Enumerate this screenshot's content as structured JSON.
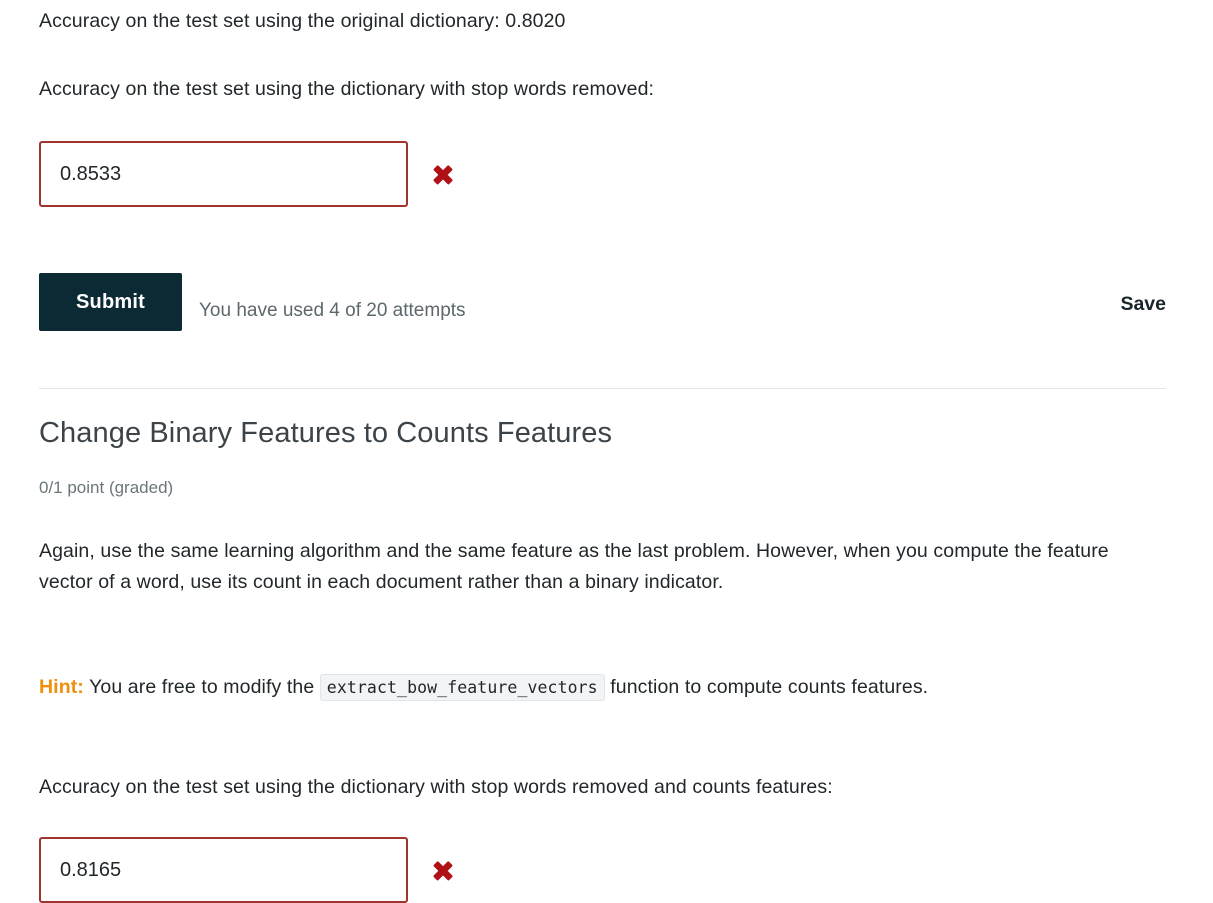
{
  "results": {
    "original_dictionary_line": "Accuracy on the test set using the original dictionary: 0.8020",
    "stopwords_removed_prompt": "Accuracy on the test set using the dictionary with stop words removed:"
  },
  "answer_1": {
    "value": "0.8533",
    "placeholder": "",
    "status": "incorrect",
    "status_icon": "cross-mark-icon",
    "border_color": "#a0332a",
    "icon_color": "#b01117"
  },
  "submit_area": {
    "submit_label": "Submit",
    "attempts_text": "You have used 4 of 20 attempts",
    "save_label": "Save",
    "button_color": "#0c2a33"
  },
  "problem": {
    "title": "Change Binary Features to Counts Features",
    "points": "0/1 point (graded)",
    "body": "Again, use the same learning algorithm and the same feature as the last problem. However, when you compute the feature vector of a word, use its count in each document rather than a binary indicator.",
    "hint_label": "Hint:",
    "hint_before_code": "You are free to modify the",
    "hint_code": "extract_bow_feature_vectors",
    "hint_after_code": "function to compute counts features.",
    "hint_color": "#ef8f0c",
    "question_prompt": "Accuracy on the test set using the dictionary with stop words removed and counts features:"
  },
  "answer_2": {
    "value": "0.8165",
    "placeholder": "",
    "status": "incorrect",
    "status_icon": "cross-mark-icon",
    "border_color": "#a0332a",
    "icon_color": "#b01117"
  }
}
